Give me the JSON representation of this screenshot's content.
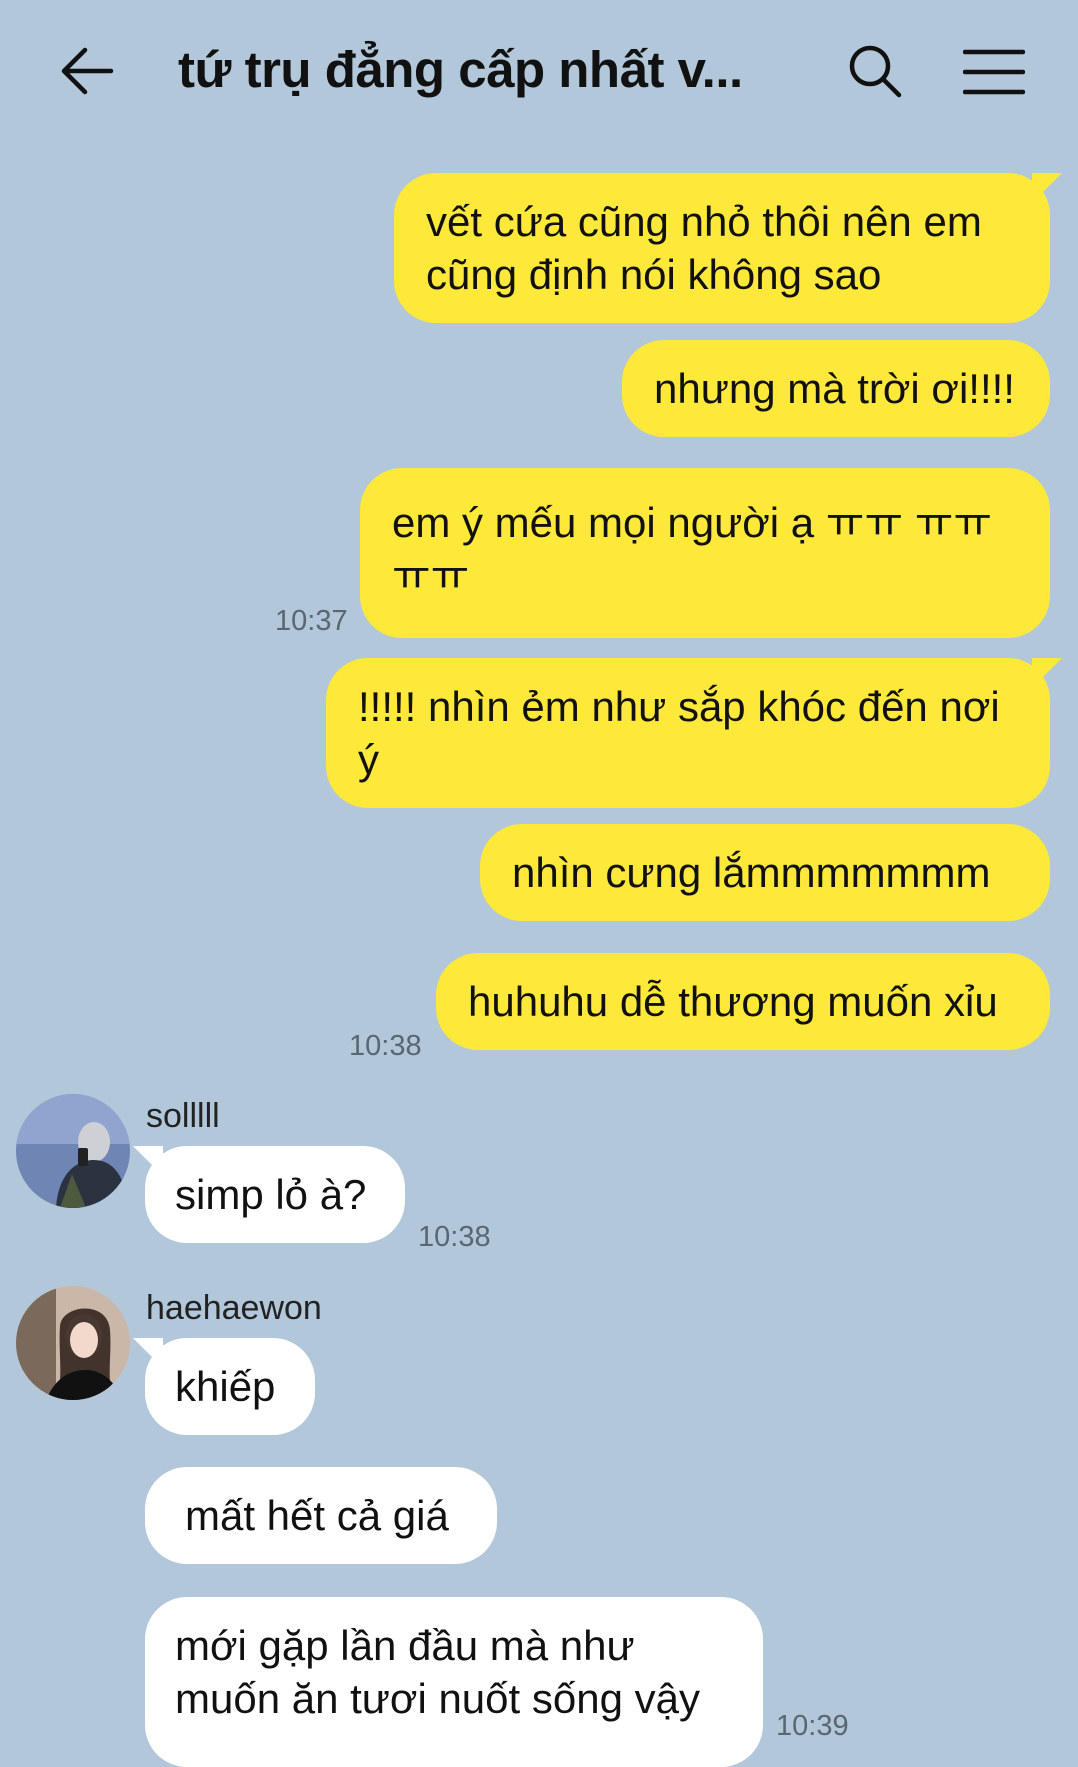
{
  "header": {
    "title": "tứ trụ đẳng cấp nhất v...",
    "back_icon": "arrow-left-icon",
    "search_icon": "search-icon",
    "menu_icon": "menu-icon"
  },
  "messages": [
    {
      "text": "vết cứa cũng nhỏ thôi nên em cũng định nói không sao"
    },
    {
      "text": "nhưng mà trời ơi!!!!"
    },
    {
      "text": "em ý mếu mọi người ạ ㅠㅠ ㅠㅠ ㅠㅠ",
      "time": "10:37"
    },
    {
      "text": "!!!!! nhìn ẻm như sắp khóc đến nơi ý"
    },
    {
      "text": "nhìn cưng lắmmmmmmm"
    },
    {
      "text": "huhuhu dễ thương muốn xỉu",
      "time": "10:38"
    },
    {
      "sender": "solllll",
      "text": "simp lỏ à?",
      "time": "10:38"
    },
    {
      "sender": "haehaewon",
      "text": "khiếp"
    },
    {
      "text": "mất hết cả giá"
    },
    {
      "text": "mới gặp lần đầu mà như muốn ăn tươi nuốt sống vậy",
      "time": "10:39"
    }
  ],
  "colors": {
    "background": "#b2c7d9",
    "my_bubble": "#fee83a",
    "their_bubble": "#ffffff"
  }
}
